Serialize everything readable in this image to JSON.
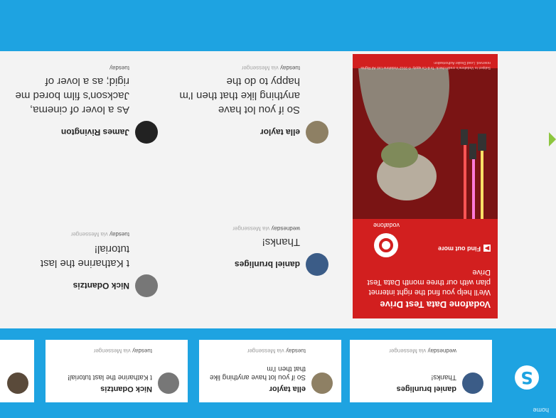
{
  "app": {
    "home_label": "home",
    "logo_letter": "S"
  },
  "recent": [
    {
      "name": "daniel brunliges",
      "message": "Thanks!",
      "day": "wednesday",
      "via": "via Messenger"
    },
    {
      "name": "ella taylor",
      "message": "So if you lot have anything like that then I'm",
      "day": "tuesday",
      "via": "via Messenger"
    },
    {
      "name": "Nick Odantzis",
      "message": "t Katharine the last tutorial!",
      "day": "tuesday",
      "via": "via Messenger"
    }
  ],
  "feed": [
    {
      "name": "daniel brunliges",
      "message": "Thanks!",
      "day": "wednesday",
      "via": "via Messenger"
    },
    {
      "name": "ella taylor",
      "message": "So if you lot have anything like that then I'm happy to do the",
      "day": "tuesday",
      "via": "via Messenger"
    },
    {
      "name": "Nick Odantzis",
      "message": "t Katharine the last tutorial!",
      "day": "tuesday",
      "via": "via Messenger"
    },
    {
      "name": "James Rivington",
      "message": "As a lover of cinema, Jackson's film bored me rigid; as a lover of",
      "day": "tuesday",
      "via": ""
    }
  ],
  "ad": {
    "title": "Vodafone Data Test Drive",
    "body": "We'll help you find the right internet plan with our three month Data Test Drive",
    "cta": "Find out more",
    "brand": "vodafone",
    "fine_print": "Subject to Vodafone's credit check. Ts & Cs apply. © 2012 Vodafone Ltd. All Rights reserved. Lead Dealer Authorisation"
  },
  "colors": {
    "skype_blue": "#1ea3e1",
    "vodafone_red": "#d21f1f"
  }
}
